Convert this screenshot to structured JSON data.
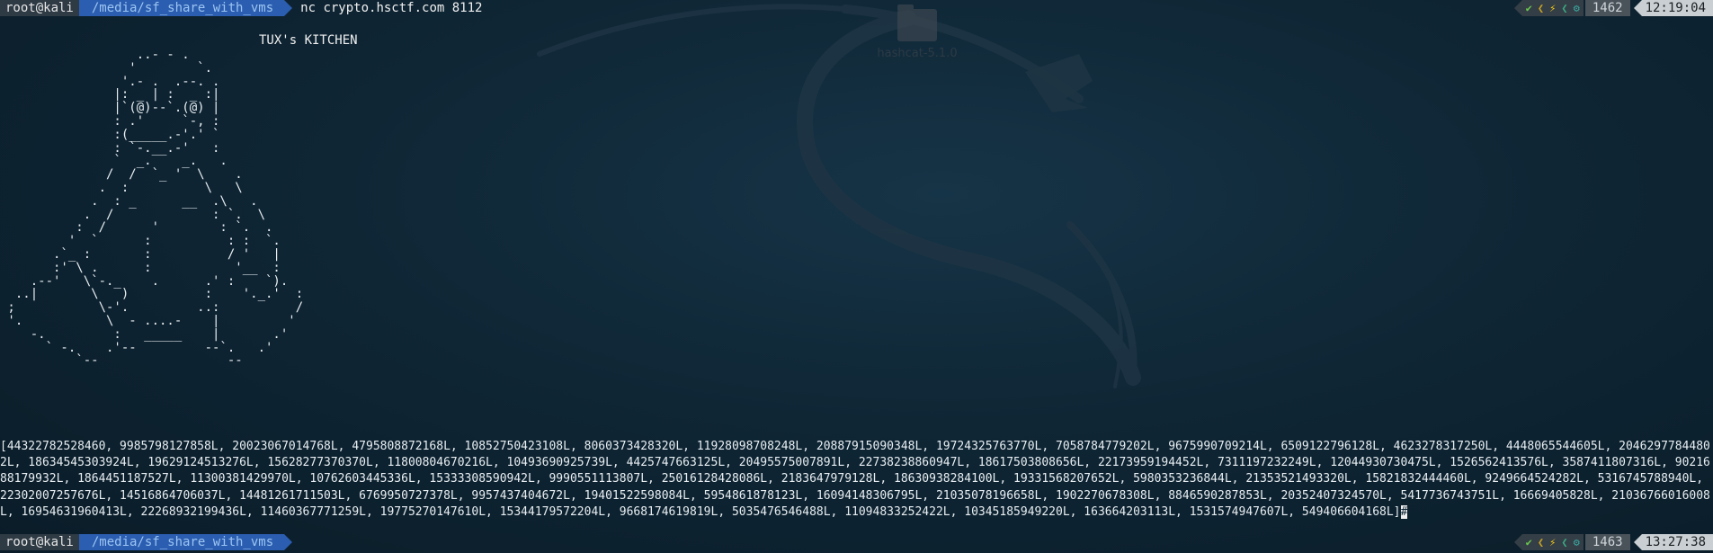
{
  "desktop": {
    "folder_label": "hashcat-5.1.0",
    "folder_icon": "folder-icon"
  },
  "prompt_top": {
    "user": "root@kali",
    "path": "/media/sf_share_with_vms",
    "command": "nc crypto.hsctf.com 8112",
    "history_num": "1462",
    "time": "12:19:04"
  },
  "prompt_bottom": {
    "user": "root@kali",
    "path": "/media/sf_share_with_vms",
    "command": "",
    "history_num": "1463",
    "time": "13:27:38"
  },
  "status_icons": [
    "check-icon",
    "left-chevron-icon",
    "bolt-icon",
    "left-chevron-icon",
    "gear-icon"
  ],
  "status_glyphs": [
    "✔",
    "❮",
    "⚡",
    "❮",
    "⚙"
  ],
  "kitchen": {
    "title": "TUX's KITCHEN",
    "ascii_art": "                  ..- - .\n                 '        `.\n                '.- .  .--. .\n               |: _ | :  _ :|\n               |`(@)--`.(@) |\n               : .'     `-, :\n               :(_____.-'.' `\n               : `-.__.-'   :\n               `  _.    _.   .\n              /  /  `_ '  \\    .\n             .  :          \\   \\\n            .  : _      __  .\\   .\n           .  /             : `.  \\\n          :  /      '        : `.  .\n         '  `      :          : :  `.\n       .`_ :       :          / '   |\n       :' \\ .      :           '__  :\n    .--'   \\`-._    .      .' :    `).\n  ..|       \\   )          :    '._.'  :\n ;           \\-'.         ..:          /\n '.           \\  - ....-    |         '\n    -.         :   _____    |       .'\n      ` -.    .'--         --`.   .'\n          `--                 --"
  },
  "output_text": "[44322782528460, 9985798127858L, 20023067014768L, 4795808872168L, 10852750423108L, 8060373428320L, 11928098708248L, 20887915090348L, 19724325763770L, 7058784779202L, 9675990709214L, 6509122796128L, 4623278317250L, 4448065544605L, 20462977844802L, 18634545303924L, 19629124513276L, 15628277370370L, 11800804670216L, 10493690925739L, 4425747663125L, 20495575007891L, 22738238860947L, 18617503808656L, 22173959194452L, 7311197232249L, 12044930730475L, 1526562413576L, 3587411807316L, 9021688179932L, 1864451187527L, 11300381429970L, 10762603445336L, 15333308590942L, 9990551113807L, 25016128428086L, 2183647979128L, 18630938284100L, 19331568207652L, 5980353236844L, 21353521493320L, 15821832444460L, 9249664524282L, 5316745788940L, 22302007257676L, 14516864706037L, 14481261711503L, 6769950727378L, 9957437404672L, 19401522598084L, 5954861878123L, 16094148306795L, 21035078196658L, 1902270678308L, 8846590287853L, 20352407324570L, 5417736743751L, 16669405828L, 21036766016008L, 16954631960413L, 22268932199436L, 11460367771259L, 19775270147610L, 15344179572204L, 9668174619819L, 5035476546488L, 11094833252422L, 10345185949220L, 163664203113L, 1531574947607L, 549406604168L]",
  "cursor_char": "#"
}
